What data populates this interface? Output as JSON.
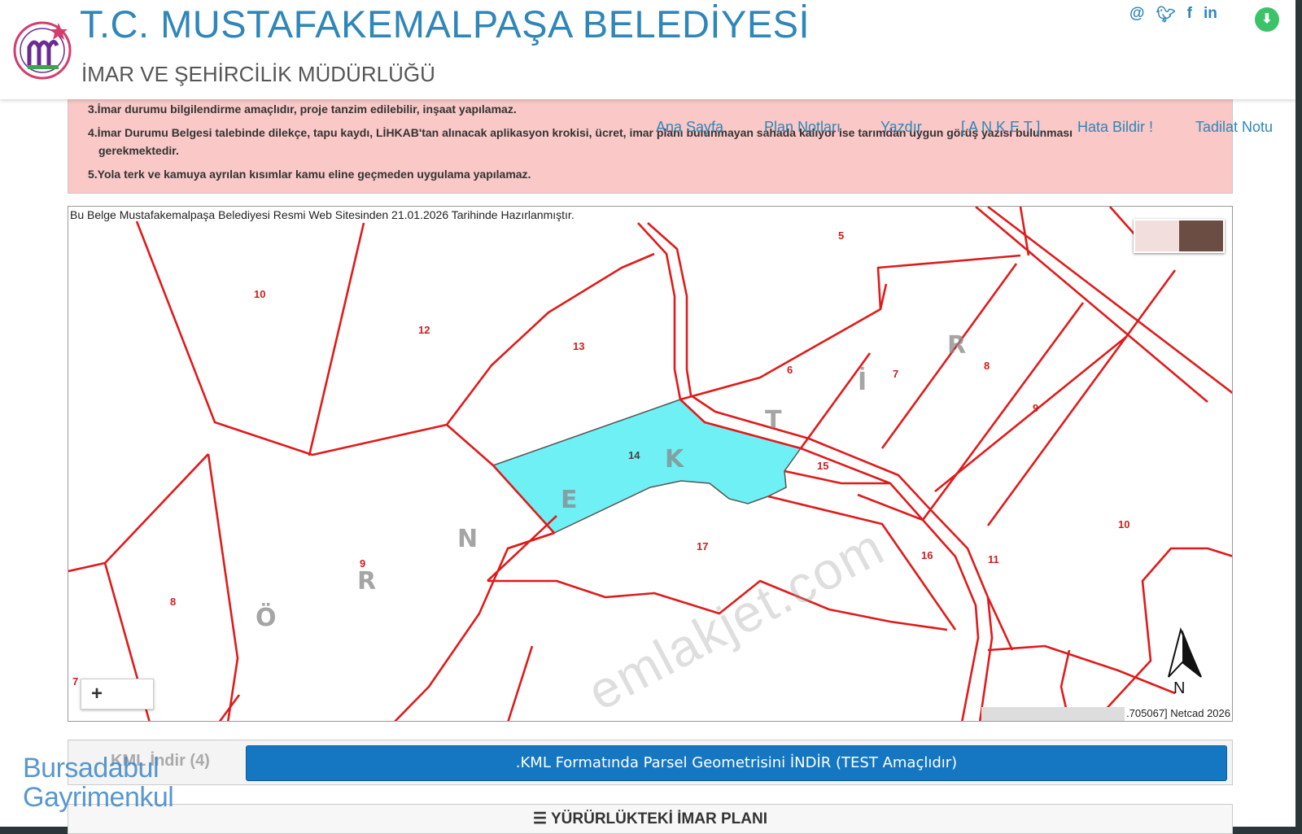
{
  "header": {
    "title": "T.C. MUSTAFAKEMALPAŞA BELEDİYESİ",
    "subtitle": "İMAR VE ŞEHİRCİLİK MÜDÜRLÜĞÜ",
    "social": [
      "@",
      "twitter-icon",
      "facebook-icon",
      "linkedin-icon"
    ],
    "download_icon": "download-icon"
  },
  "nav": {
    "items": [
      "Ana Sayfa",
      "Plan Notları",
      "Yazdır",
      "[ A N K E T ]",
      "Hata Bildir !",
      "Tadilat Notu"
    ]
  },
  "notice": {
    "line3": "3.İmar durumu bilgilendirme amaçlıdır, proje tanzim edilebilir, inşaat yapılamaz.",
    "line4a": "4.İmar Durumu Belgesi talebinde dilekçe, tapu kaydı, LİHKAB'tan alınacak aplikasyon krokisi, ücret, imar planı bulunmayan sahada kalıyor ise tarımdan uygun görüş yazısı bulunması",
    "line4b": "gerekmektedir.",
    "line5": "5.Yola terk ve kamuya ayrılan kısımlar kamu eline geçmeden uygulama yapılamaz."
  },
  "map": {
    "caption": "Bu Belge Mustafakemalpaşa Belediyesi Resmi Web Sitesinden 21.01.2026 Tarihinde Hazırlanmıştır.",
    "parcel_numbers": [
      "10",
      "12",
      "13",
      "5",
      "6",
      "7",
      "8",
      "9",
      "14",
      "15",
      "17",
      "16",
      "11",
      "10",
      "9",
      "8",
      "7"
    ],
    "overlay_letters": [
      "Ö",
      "R",
      "N",
      "E",
      "K",
      "T",
      "İ",
      "R"
    ],
    "faint_watermark": "emlakjet.com",
    "zoom_label": "+",
    "attribution": ".705067] Netcad 2026",
    "north_label": "N",
    "highlight_color": "#6ff0f4",
    "line_color": "#e01a1a"
  },
  "kml": {
    "label": "KML İndir (4)",
    "button": ".KML Formatında Parsel Geometrisini İNDİR (TEST Amaçlıdır)"
  },
  "plan": {
    "heading": "YÜRÜRLÜKTEKİ İMAR PLANI"
  },
  "watermark": {
    "line1": "Bursadabul",
    "line2": "Gayrimenkul"
  }
}
